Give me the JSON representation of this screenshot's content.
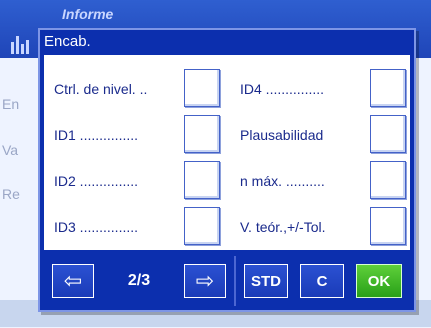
{
  "background": {
    "title": "Informe",
    "labels": [
      "En",
      "Va",
      "Re"
    ]
  },
  "dialog": {
    "title": "Encab.",
    "left_items": [
      {
        "label": "Ctrl. de nivel. .."
      },
      {
        "label": "ID1 ..............."
      },
      {
        "label": "ID2 ..............."
      },
      {
        "label": "ID3 ..............."
      }
    ],
    "right_items": [
      {
        "label": "ID4 ..............."
      },
      {
        "label": "Plausabilidad"
      },
      {
        "label": "n máx. .........."
      },
      {
        "label": "V. teór.,+/-Tol."
      }
    ],
    "page_indicator": "2/3",
    "buttons": {
      "prev": "⇦",
      "next": "⇨",
      "std": "STD",
      "clear": "C",
      "ok": "OK"
    }
  },
  "colors": {
    "dialog_bg": "#0c2fae",
    "label_text": "#1a2a8c",
    "ok_button": "#3cb424"
  }
}
